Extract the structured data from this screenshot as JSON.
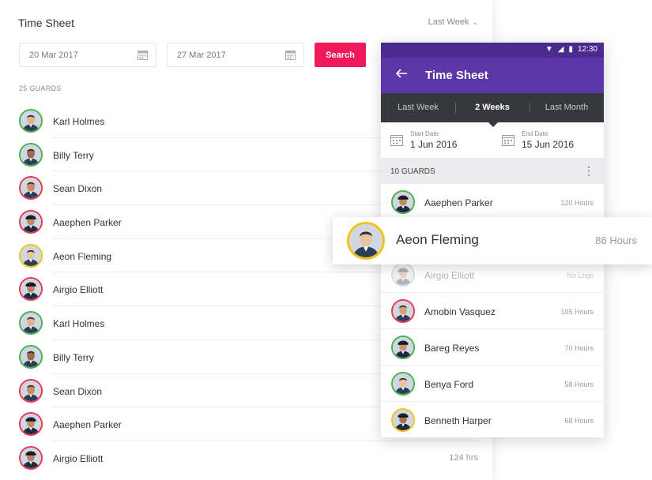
{
  "desktop": {
    "title": "Time Sheet",
    "period": "Last Week",
    "start_date": "20 Mar 2017",
    "end_date": "27 Mar 2017",
    "search_label": "Search",
    "guards_count": "25 GUARDS",
    "guards": [
      {
        "name": "Karl Holmes",
        "hours": "",
        "ring": "#4caf50",
        "skin": "#e0b38f",
        "hat": false
      },
      {
        "name": "Billy Terry",
        "hours": "",
        "ring": "#4caf50",
        "skin": "#9a6a4a",
        "hat": false
      },
      {
        "name": "Sean Dixon",
        "hours": "",
        "ring": "#e53950",
        "skin": "#c98b62",
        "hat": false
      },
      {
        "name": "Aaephen Parker",
        "hours": "",
        "ring": "#e53950",
        "skin": "#c08a66",
        "hat": true
      },
      {
        "name": "Aeon Fleming",
        "hours": "",
        "ring": "#f2c21b",
        "skin": "#e8c4a5",
        "hat": false
      },
      {
        "name": "Airgio Elliott",
        "hours": "",
        "ring": "#e53950",
        "skin": "#b98465",
        "hat": true
      },
      {
        "name": "Karl Holmes",
        "hours": "",
        "ring": "#4caf50",
        "skin": "#e0b38f",
        "hat": false
      },
      {
        "name": "Billy Terry",
        "hours": "",
        "ring": "#4caf50",
        "skin": "#9a6a4a",
        "hat": false
      },
      {
        "name": "Sean Dixon",
        "hours": "",
        "ring": "#e53950",
        "skin": "#c98b62",
        "hat": false
      },
      {
        "name": "Aaephen Parker",
        "hours": "",
        "ring": "#e53950",
        "skin": "#c08a66",
        "hat": true
      },
      {
        "name": "Airgio Elliott",
        "hours": "124 hrs",
        "ring": "#e53950",
        "skin": "#b98465",
        "hat": true
      }
    ]
  },
  "mobile": {
    "status_time": "12:30",
    "title": "Time Sheet",
    "tabs": [
      "Last Week",
      "2 Weeks",
      "Last Month"
    ],
    "active_tab": 1,
    "start_label": "Start Date",
    "start_value": "1 Jun 2016",
    "end_label": "End Date",
    "end_value": "15 Jun 2016",
    "guards_count": "10 GUARDS",
    "guards": [
      {
        "name": "Aaephen Parker",
        "hours": "120 Hours",
        "ring": "#4caf50",
        "skin": "#c08a66",
        "hat": true,
        "dim": false
      },
      {
        "name": "Airgio Elliott",
        "hours": "No Logs",
        "ring": "#9e9e9e",
        "skin": "#b98465",
        "hat": true,
        "dim": true
      },
      {
        "name": "Amobin Vasquez",
        "hours": "105 Hours",
        "ring": "#e53950",
        "skin": "#d6a07a",
        "hat": false,
        "dim": false
      },
      {
        "name": "Bareg Reyes",
        "hours": "70 Hours",
        "ring": "#4caf50",
        "skin": "#c79372",
        "hat": true,
        "dim": false
      },
      {
        "name": "Benya Ford",
        "hours": "58 Hours",
        "ring": "#4caf50",
        "skin": "#e8c4a5",
        "hat": false,
        "dim": false
      },
      {
        "name": "Benneth Harper",
        "hours": "68 Hours",
        "ring": "#f2c21b",
        "skin": "#a87352",
        "hat": true,
        "dim": false
      }
    ]
  },
  "highlight": {
    "name": "Aeon Fleming",
    "hours": "86 Hours",
    "ring": "#f2c21b",
    "skin": "#e8c4a5"
  },
  "colors": {
    "search_button": "#f0195a",
    "app_bar": "#5c36a8",
    "status_bar": "#4a2a8f",
    "tab_bar": "#37383f",
    "ring_active": "#4caf50",
    "ring_late": "#e53950",
    "ring_featured": "#f2c21b"
  }
}
